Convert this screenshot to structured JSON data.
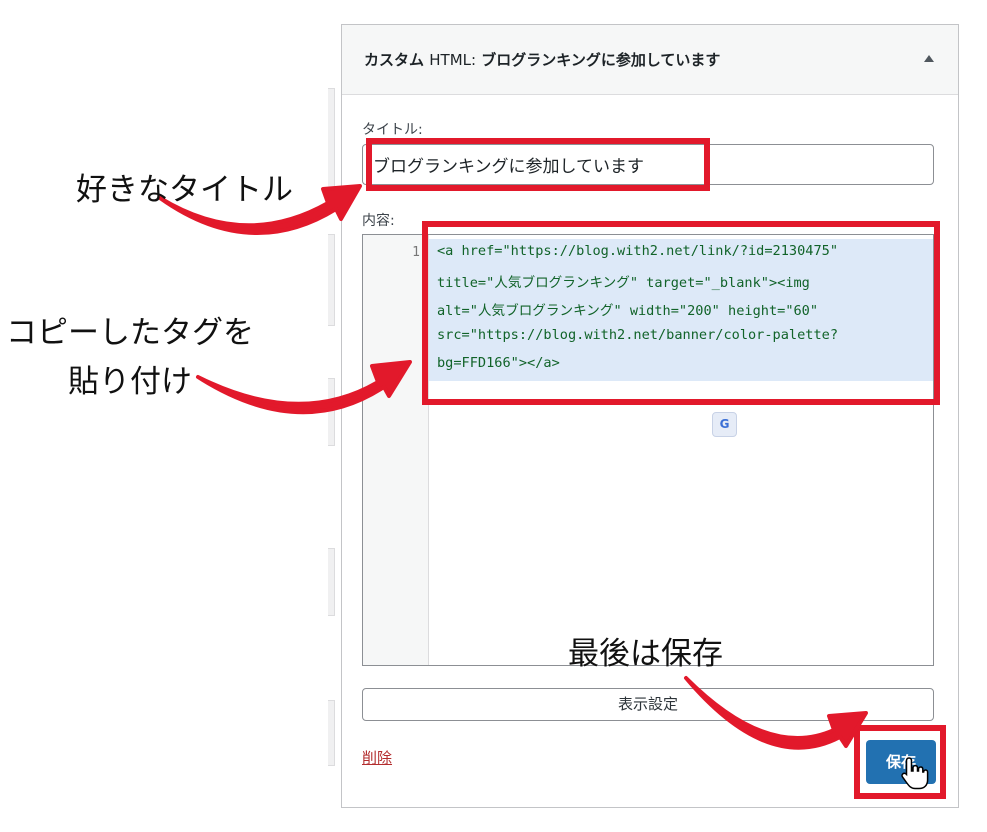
{
  "panel": {
    "title_bold": "カスタム",
    "title_en": "HTML:",
    "title_rest": "ブログランキングに参加しています"
  },
  "form": {
    "title_label": "タイトル:",
    "title_value": "ブログランキングに参加しています",
    "content_label": "内容:",
    "line_number": "1",
    "code_lines": [
      "<a href=\"https://blog.with2.net/link/?id=2130475\"",
      "title=\"人気ブログランキング\" target=\"_blank\"><img",
      "alt=\"人気ブログランキング\" width=\"200\" height=\"60\"",
      "src=\"https://blog.with2.net/banner/color-palette?",
      "bg=FFD166\"></a>"
    ],
    "translate_icon": "G"
  },
  "actions": {
    "display_settings": "表示設定",
    "delete": "削除",
    "save": "保存"
  },
  "annotations": {
    "favorite_title": "好きなタイトル",
    "paste_tag_line1": "コピーしたタグを",
    "paste_tag_line2": "貼り付け",
    "finally_save": "最後は保存"
  },
  "colors": {
    "highlight_red": "#e2192b",
    "save_blue": "#2271b1",
    "delete_red": "#b32d2e"
  }
}
